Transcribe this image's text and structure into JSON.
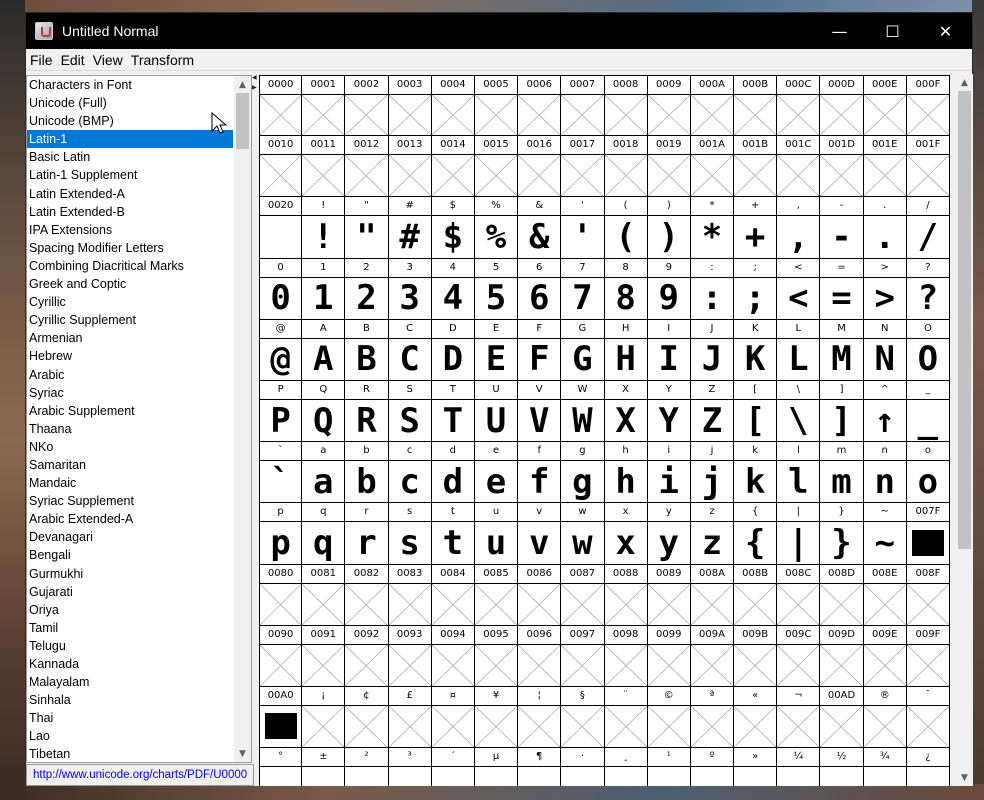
{
  "window": {
    "title": "Untitled Normal",
    "controls": {
      "minimize": "—",
      "maximize": "☐",
      "close": "✕"
    }
  },
  "menu": [
    "File",
    "Edit",
    "View",
    "Transform"
  ],
  "blocks": {
    "selected_index": 3,
    "items": [
      "Characters in Font",
      "Unicode (Full)",
      "Unicode (BMP)",
      "Latin-1",
      "Basic Latin",
      "Latin-1 Supplement",
      "Latin Extended-A",
      "Latin Extended-B",
      "IPA Extensions",
      "Spacing Modifier Letters",
      "Combining Diacritical Marks",
      "Greek and Coptic",
      "Cyrillic",
      "Cyrillic Supplement",
      "Armenian",
      "Hebrew",
      "Arabic",
      "Syriac",
      "Arabic Supplement",
      "Thaana",
      "NKo",
      "Samaritan",
      "Mandaic",
      "Syriac Supplement",
      "Arabic Extended-A",
      "Devanagari",
      "Bengali",
      "Gurmukhi",
      "Gujarati",
      "Oriya",
      "Tamil",
      "Telugu",
      "Kannada",
      "Malayalam",
      "Sinhala",
      "Thai",
      "Lao",
      "Tibetan"
    ]
  },
  "url": "http://www.unicode.org/charts/PDF/U0000",
  "glyph_rows": [
    {
      "labels": [
        "0000",
        "0001",
        "0002",
        "0003",
        "0004",
        "0005",
        "0006",
        "0007",
        "0008",
        "0009",
        "000A",
        "000B",
        "000C",
        "000D",
        "000E",
        "000F"
      ],
      "glyphs": [
        "",
        "",
        "",
        "",
        "",
        "",
        "",
        "",
        "",
        "",
        "",
        "",
        "",
        "",
        "",
        ""
      ],
      "empty": [
        1,
        1,
        1,
        1,
        1,
        1,
        1,
        1,
        1,
        1,
        1,
        1,
        1,
        1,
        1,
        1
      ]
    },
    {
      "labels": [
        "0010",
        "0011",
        "0012",
        "0013",
        "0014",
        "0015",
        "0016",
        "0017",
        "0018",
        "0019",
        "001A",
        "001B",
        "001C",
        "001D",
        "001E",
        "001F"
      ],
      "glyphs": [
        "",
        "",
        "",
        "",
        "",
        "",
        "",
        "",
        "",
        "",
        "",
        "",
        "",
        "",
        "",
        ""
      ],
      "empty": [
        1,
        1,
        1,
        1,
        1,
        1,
        1,
        1,
        1,
        1,
        1,
        1,
        1,
        1,
        1,
        1
      ]
    },
    {
      "labels": [
        "0020",
        "!",
        "\"",
        "#",
        "$",
        "%",
        "&",
        "'",
        "(",
        ")",
        "*",
        "+",
        ",",
        "-",
        ".",
        "/"
      ],
      "glyphs": [
        "",
        "!",
        "\"",
        "#",
        "$",
        "%",
        "&",
        "'",
        "(",
        ")",
        "*",
        "+",
        ",",
        "-",
        ".",
        "/"
      ],
      "empty": [
        0,
        0,
        0,
        0,
        0,
        0,
        0,
        0,
        0,
        0,
        0,
        0,
        0,
        0,
        0,
        0
      ]
    },
    {
      "labels": [
        "0",
        "1",
        "2",
        "3",
        "4",
        "5",
        "6",
        "7",
        "8",
        "9",
        ":",
        ";",
        "<",
        "=",
        ">",
        "?"
      ],
      "glyphs": [
        "0",
        "1",
        "2",
        "3",
        "4",
        "5",
        "6",
        "7",
        "8",
        "9",
        ":",
        ";",
        "<",
        "=",
        ">",
        "?"
      ],
      "empty": [
        0,
        0,
        0,
        0,
        0,
        0,
        0,
        0,
        0,
        0,
        0,
        0,
        0,
        0,
        0,
        0
      ]
    },
    {
      "labels": [
        "@",
        "A",
        "B",
        "C",
        "D",
        "E",
        "F",
        "G",
        "H",
        "I",
        "J",
        "K",
        "L",
        "M",
        "N",
        "O"
      ],
      "glyphs": [
        "@",
        "A",
        "B",
        "C",
        "D",
        "E",
        "F",
        "G",
        "H",
        "I",
        "J",
        "K",
        "L",
        "M",
        "N",
        "O"
      ],
      "empty": [
        0,
        0,
        0,
        0,
        0,
        0,
        0,
        0,
        0,
        0,
        0,
        0,
        0,
        0,
        0,
        0
      ]
    },
    {
      "labels": [
        "P",
        "Q",
        "R",
        "S",
        "T",
        "U",
        "V",
        "W",
        "X",
        "Y",
        "Z",
        "[",
        "\\",
        "]",
        "^",
        "_"
      ],
      "glyphs": [
        "P",
        "Q",
        "R",
        "S",
        "T",
        "U",
        "V",
        "W",
        "X",
        "Y",
        "Z",
        "[",
        "\\",
        "]",
        "↑",
        "_"
      ],
      "empty": [
        0,
        0,
        0,
        0,
        0,
        0,
        0,
        0,
        0,
        0,
        0,
        0,
        0,
        0,
        0,
        0
      ]
    },
    {
      "labels": [
        "`",
        "a",
        "b",
        "c",
        "d",
        "e",
        "f",
        "g",
        "h",
        "i",
        "j",
        "k",
        "l",
        "m",
        "n",
        "o"
      ],
      "glyphs": [
        "`",
        "a",
        "b",
        "c",
        "d",
        "e",
        "f",
        "g",
        "h",
        "i",
        "j",
        "k",
        "l",
        "m",
        "n",
        "o"
      ],
      "empty": [
        0,
        0,
        0,
        0,
        0,
        0,
        0,
        0,
        0,
        0,
        0,
        0,
        0,
        0,
        0,
        0
      ]
    },
    {
      "labels": [
        "p",
        "q",
        "r",
        "s",
        "t",
        "u",
        "v",
        "w",
        "x",
        "y",
        "z",
        "{",
        "|",
        "}",
        "~",
        "007F"
      ],
      "glyphs": [
        "p",
        "q",
        "r",
        "s",
        "t",
        "u",
        "v",
        "w",
        "x",
        "y",
        "z",
        "{",
        "|",
        "}",
        "~",
        ""
      ],
      "empty": [
        0,
        0,
        0,
        0,
        0,
        0,
        0,
        0,
        0,
        0,
        0,
        0,
        0,
        0,
        0,
        0
      ]
    },
    {
      "labels": [
        "0080",
        "0081",
        "0082",
        "0083",
        "0084",
        "0085",
        "0086",
        "0087",
        "0088",
        "0089",
        "008A",
        "008B",
        "008C",
        "008D",
        "008E",
        "008F"
      ],
      "glyphs": [
        "",
        "",
        "",
        "",
        "",
        "",
        "",
        "",
        "",
        "",
        "",
        "",
        "",
        "",
        "",
        ""
      ],
      "empty": [
        1,
        1,
        1,
        1,
        1,
        1,
        1,
        1,
        1,
        1,
        1,
        1,
        1,
        1,
        1,
        1
      ]
    },
    {
      "labels": [
        "0090",
        "0091",
        "0092",
        "0093",
        "0094",
        "0095",
        "0096",
        "0097",
        "0098",
        "0099",
        "009A",
        "009B",
        "009C",
        "009D",
        "009E",
        "009F"
      ],
      "glyphs": [
        "",
        "",
        "",
        "",
        "",
        "",
        "",
        "",
        "",
        "",
        "",
        "",
        "",
        "",
        "",
        ""
      ],
      "empty": [
        1,
        1,
        1,
        1,
        1,
        1,
        1,
        1,
        1,
        1,
        1,
        1,
        1,
        1,
        1,
        1
      ]
    },
    {
      "labels": [
        "00A0",
        "¡",
        "¢",
        "£",
        "¤",
        "¥",
        "¦",
        "§",
        "¨",
        "©",
        "ª",
        "«",
        "¬",
        "00AD",
        "®",
        "¯"
      ],
      "glyphs": [
        "",
        "",
        "",
        "",
        "",
        "",
        "",
        "",
        "",
        "",
        "",
        "",
        "",
        "",
        "",
        ""
      ],
      "empty": [
        0,
        1,
        1,
        1,
        1,
        1,
        1,
        1,
        1,
        1,
        1,
        1,
        1,
        1,
        1,
        1
      ]
    },
    {
      "labels": [
        "°",
        "±",
        "²",
        "³",
        "´",
        "µ",
        "¶",
        "·",
        "¸",
        "¹",
        "º",
        "»",
        "¼",
        "½",
        "¾",
        "¿"
      ],
      "glyphs": [
        "",
        "",
        "",
        "",
        "",
        "",
        "",
        "",
        "",
        "",
        "",
        "",
        "",
        "",
        "",
        ""
      ],
      "empty": [
        0,
        0,
        0,
        0,
        0,
        0,
        0,
        0,
        0,
        0,
        0,
        0,
        0,
        0,
        0,
        0
      ]
    }
  ],
  "block_cells": [
    "007F",
    "00A0"
  ]
}
